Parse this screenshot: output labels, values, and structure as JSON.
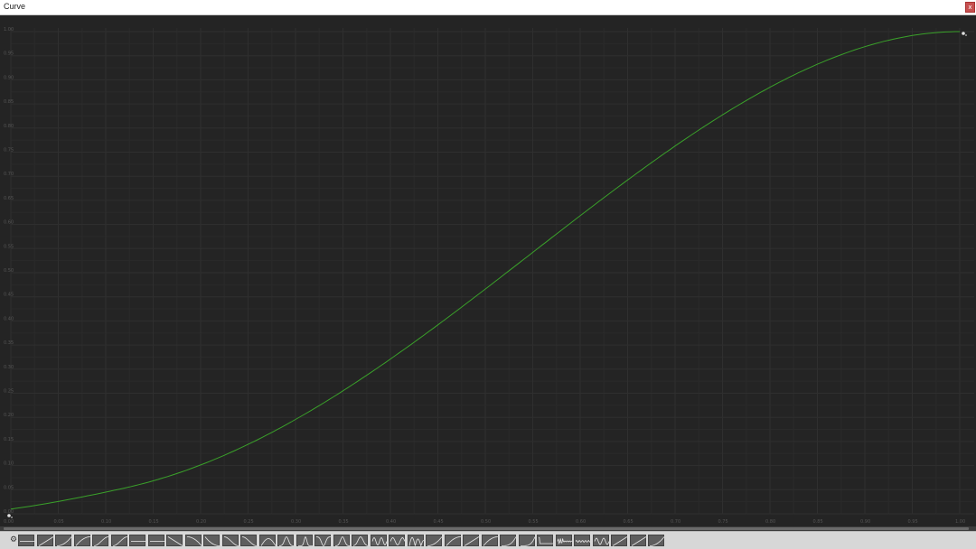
{
  "window": {
    "title": "Curve",
    "close_glyph": "x"
  },
  "curve_editor": {
    "background": "#242424",
    "curve_color": "#3aa12a",
    "grid_color": "#2f2f2f",
    "label_color": "#555555",
    "x_ticks": [
      "0.00",
      "0.05",
      "0.10",
      "0.15",
      "0.20",
      "0.25",
      "0.30",
      "0.35",
      "0.40",
      "0.45",
      "0.50",
      "0.55",
      "0.60",
      "0.65",
      "0.70",
      "0.75",
      "0.80",
      "0.85",
      "0.90",
      "0.95",
      "1.00"
    ],
    "y_ticks": [
      "1.00",
      "0.95",
      "0.90",
      "0.85",
      "0.80",
      "0.75",
      "0.70",
      "0.65",
      "0.60",
      "0.55",
      "0.50",
      "0.45",
      "0.40",
      "0.35",
      "0.30",
      "0.25",
      "0.20",
      "0.15",
      "0.10",
      "0.05",
      "0.00"
    ],
    "x_range": [
      0,
      1
    ],
    "y_range": [
      0,
      1
    ],
    "keys": [
      {
        "time": 0.0,
        "value": 0.0
      },
      {
        "time": 1.0,
        "value": 1.0
      }
    ],
    "key_icon": "key-handle-icon"
  },
  "preset_bar": {
    "settings_icon": "gear-icon",
    "presets": [
      "flat",
      "linear",
      "ease-in",
      "ease-out",
      "ease-in-out",
      "ease-in-out-2",
      "flat-high",
      "flat-mid",
      "linear-down",
      "ease-in-down",
      "ease-out-down",
      "ease-in-out-down",
      "ease-in-out-down-2",
      "bump",
      "bell",
      "bell-sharp",
      "valley",
      "bell-2",
      "bell-3",
      "wave",
      "wave-2",
      "bounce",
      "ease-in-2",
      "ease-out-2",
      "linear-2",
      "ease-out-3",
      "curve-up",
      "curve-up-2",
      "step",
      "noise",
      "noise-2",
      "wave-3",
      "diagonal",
      "diagonal-2",
      "ease-in-3"
    ]
  }
}
